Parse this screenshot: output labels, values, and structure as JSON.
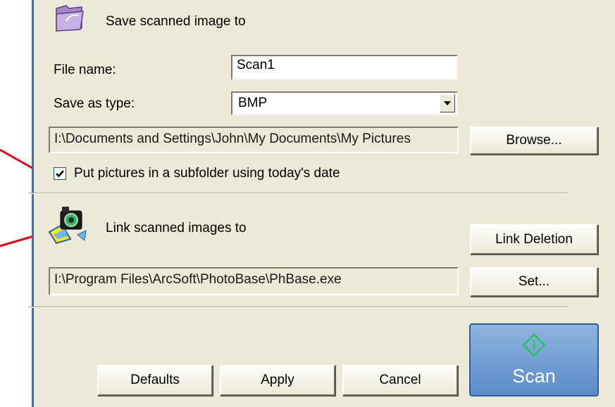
{
  "save_section": {
    "title": "Save scanned image to",
    "file_name_label": "File name:",
    "file_name_value": "Scan1",
    "save_as_type_label": "Save as type:",
    "save_as_type_value": "BMP",
    "path": "I:\\Documents and Settings\\John\\My Documents\\My Pictures",
    "browse_label": "Browse...",
    "subfolder_checkbox_label": "Put pictures in a subfolder using today's date",
    "subfolder_checked": true
  },
  "link_section": {
    "title": "Link scanned images to",
    "link_deletion_label": "Link Deletion",
    "path": "I:\\Program Files\\ArcSoft\\PhotoBase\\PhBase.exe",
    "set_label": "Set..."
  },
  "footer": {
    "defaults_label": "Defaults",
    "apply_label": "Apply",
    "cancel_label": "Cancel",
    "scan_label": "Scan"
  },
  "icons": {
    "save_folder": "folder-icon",
    "link_camera": "camera-icon",
    "scan": "diamond-info-icon"
  },
  "colors": {
    "panel_bg": "#ece9d8",
    "window_border": "#3a6ea5",
    "annotation_red": "#e0001a",
    "scan_button": "#6b9bd2",
    "scan_icon": "#22c55e"
  }
}
